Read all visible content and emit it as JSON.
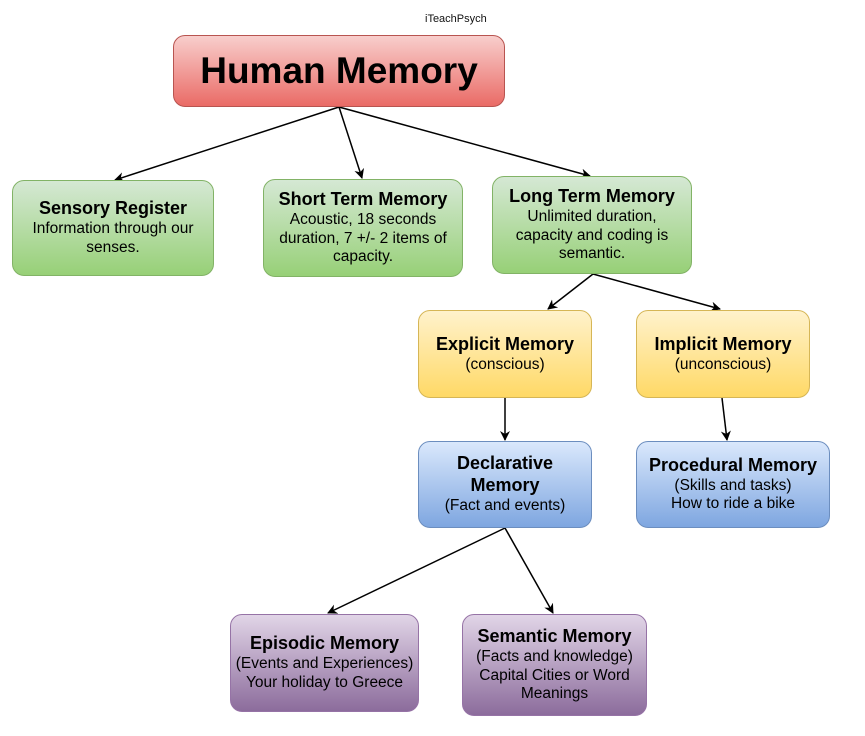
{
  "credit": "iTeachPsych",
  "nodes": {
    "root": {
      "title": "Human Memory",
      "color": "#ea6b66"
    },
    "sensory": {
      "title": "Sensory Register",
      "desc": "Information through our senses.",
      "color": "#97d077"
    },
    "stm": {
      "title": "Short Term Memory",
      "desc": "Acoustic, 18 seconds duration, 7 +/- 2 items of capacity.",
      "color": "#97d077"
    },
    "ltm": {
      "title": "Long Term Memory",
      "desc": "Unlimited duration, capacity and coding is semantic.",
      "color": "#97d077"
    },
    "explicit": {
      "title": "Explicit Memory",
      "desc": "(conscious)",
      "color": "#ffd966"
    },
    "implicit": {
      "title": "Implicit Memory",
      "desc": "(unconscious)",
      "color": "#ffd966"
    },
    "declarative": {
      "title": "Declarative Memory",
      "desc": "(Fact and events)",
      "color": "#7ea6e0"
    },
    "procedural": {
      "title": "Procedural Memory",
      "desc": "(Skills and tasks) How to ride a bike",
      "color": "#7ea6e0"
    },
    "episodic": {
      "title": "Episodic Memory",
      "desc": "(Events and Experiences) Your holiday to Greece",
      "color": "#8c6c9c"
    },
    "semantic": {
      "title": "Semantic Memory",
      "desc": "(Facts and knowledge) Capital Cities or Word Meanings",
      "color": "#8c6c9c"
    }
  },
  "edges": [
    {
      "from": "root",
      "to": "sensory"
    },
    {
      "from": "root",
      "to": "stm"
    },
    {
      "from": "root",
      "to": "ltm"
    },
    {
      "from": "ltm",
      "to": "explicit"
    },
    {
      "from": "ltm",
      "to": "implicit"
    },
    {
      "from": "explicit",
      "to": "declarative"
    },
    {
      "from": "implicit",
      "to": "procedural"
    },
    {
      "from": "declarative",
      "to": "episodic"
    },
    {
      "from": "declarative",
      "to": "semantic"
    }
  ]
}
